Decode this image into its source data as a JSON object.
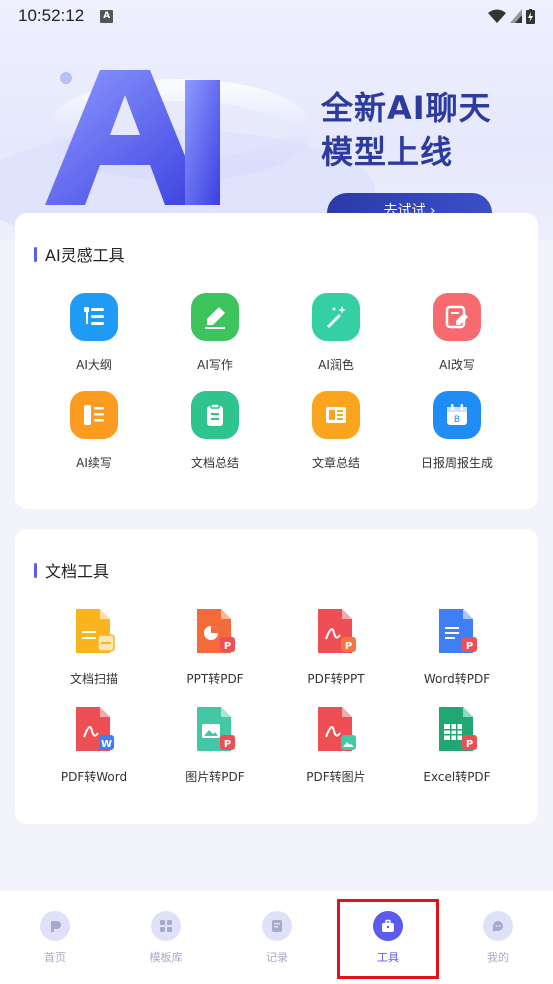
{
  "status_bar": {
    "time": "10:52:12",
    "notification_icon": "A"
  },
  "banner": {
    "headline_line1": "全新AI聊天",
    "headline_line2": "模型上线",
    "button_label": "去试试 ›"
  },
  "ai_tools": {
    "title": "AI灵感工具",
    "items": [
      {
        "label": "AI大纲",
        "icon": "outline-icon",
        "color": "#1f9bf5"
      },
      {
        "label": "AI写作",
        "icon": "pen-icon",
        "color": "#3ec45c"
      },
      {
        "label": "AI润色",
        "icon": "magic-wand-icon",
        "color": "#35cfa6"
      },
      {
        "label": "AI改写",
        "icon": "edit-icon",
        "color": "#f56b6f"
      },
      {
        "label": "AI续写",
        "icon": "continue-writing-icon",
        "color": "#fb9b1f"
      },
      {
        "label": "文档总结",
        "icon": "clipboard-icon",
        "color": "#2fc38e"
      },
      {
        "label": "文章总结",
        "icon": "article-icon",
        "color": "#fba41e"
      },
      {
        "label": "日报周报生成",
        "icon": "calendar-icon",
        "color": "#1f8df5"
      }
    ]
  },
  "doc_tools": {
    "title": "文档工具",
    "items": [
      {
        "label": "文档扫描",
        "icon": "scan-doc-icon",
        "color": "#fbb31e"
      },
      {
        "label": "PPT转PDF",
        "icon": "ppt-to-pdf-icon",
        "color": "#f56a3a"
      },
      {
        "label": "PDF转PPT",
        "icon": "pdf-to-ppt-icon",
        "color": "#ee4f55"
      },
      {
        "label": "Word转PDF",
        "icon": "word-to-pdf-icon",
        "color": "#3f7ef3"
      },
      {
        "label": "PDF转Word",
        "icon": "pdf-to-word-icon",
        "color": "#ee4f55"
      },
      {
        "label": "图片转PDF",
        "icon": "image-to-pdf-icon",
        "color": "#43c7a6"
      },
      {
        "label": "PDF转图片",
        "icon": "pdf-to-image-icon",
        "color": "#ee4f55"
      },
      {
        "label": "Excel转PDF",
        "icon": "excel-to-pdf-icon",
        "color": "#1fa774"
      }
    ]
  },
  "tabbar": {
    "items": [
      {
        "label": "首页",
        "icon": "home-icon"
      },
      {
        "label": "模板库",
        "icon": "template-grid-icon"
      },
      {
        "label": "记录",
        "icon": "record-icon"
      },
      {
        "label": "工具",
        "icon": "toolbox-icon",
        "active": true
      },
      {
        "label": "我的",
        "icon": "profile-icon"
      }
    ]
  },
  "colors": {
    "accent": "#5b5bf0",
    "highlight": "#e0141a",
    "banner_text": "#2d3a9e"
  }
}
